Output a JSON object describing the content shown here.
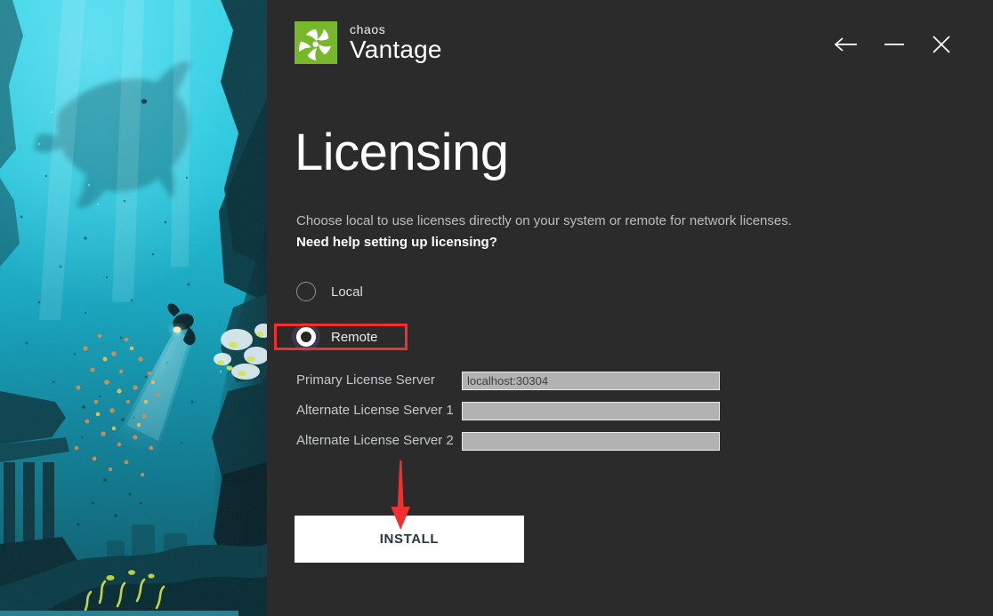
{
  "window": {
    "background_color": "#2b2b2b",
    "controls": [
      {
        "name": "back",
        "icon": "arrow-left-icon",
        "label": "Back"
      },
      {
        "name": "minimize",
        "icon": "minimize-icon",
        "label": "Minimize"
      },
      {
        "name": "close",
        "icon": "close-icon",
        "label": "Close"
      }
    ]
  },
  "brand": {
    "mark_icon": "chaos-pinwheel-icon",
    "mark_color": "#76b82a",
    "company": "chaos",
    "product": "Vantage"
  },
  "hero": {
    "name": "underwater-scene-artwork",
    "description": "Underwater scene with whale shark silhouette, diver with flashlight, schools of orange and yellow fish, and submerged stone ruins with columns",
    "colors": {
      "water_light": "#22c6dd",
      "water_mid": "#12a8bf",
      "water_deep": "#0c5f70",
      "rock_dark": "#0a3b45",
      "fish_orange": "#e08c4a",
      "fish_yellow": "#e8e246",
      "light_beam": "#a9e6e8",
      "bottom_strip": "#2b7f92"
    }
  },
  "page": {
    "title": "Licensing",
    "subtitle": "Choose local to use licenses directly on your system or remote for network licenses.",
    "help_link": "Need help setting up licensing?"
  },
  "license_mode": {
    "selected": "Remote",
    "options": [
      {
        "label": "Local",
        "selected": false
      },
      {
        "label": "Remote",
        "selected": true
      }
    ]
  },
  "fields": [
    {
      "label": "Primary License Server",
      "value": "localhost:30304",
      "placeholder": ""
    },
    {
      "label": "Alternate License Server 1",
      "value": "",
      "placeholder": ""
    },
    {
      "label": "Alternate License Server 2",
      "value": "",
      "placeholder": ""
    }
  ],
  "actions": {
    "install_label": "INSTALL"
  },
  "annotations": {
    "highlight_color": "#f22f2f",
    "highlight_target": "Remote",
    "arrow_color": "#f22f2f",
    "arrow_target": "INSTALL",
    "arrow_direction": "down"
  }
}
